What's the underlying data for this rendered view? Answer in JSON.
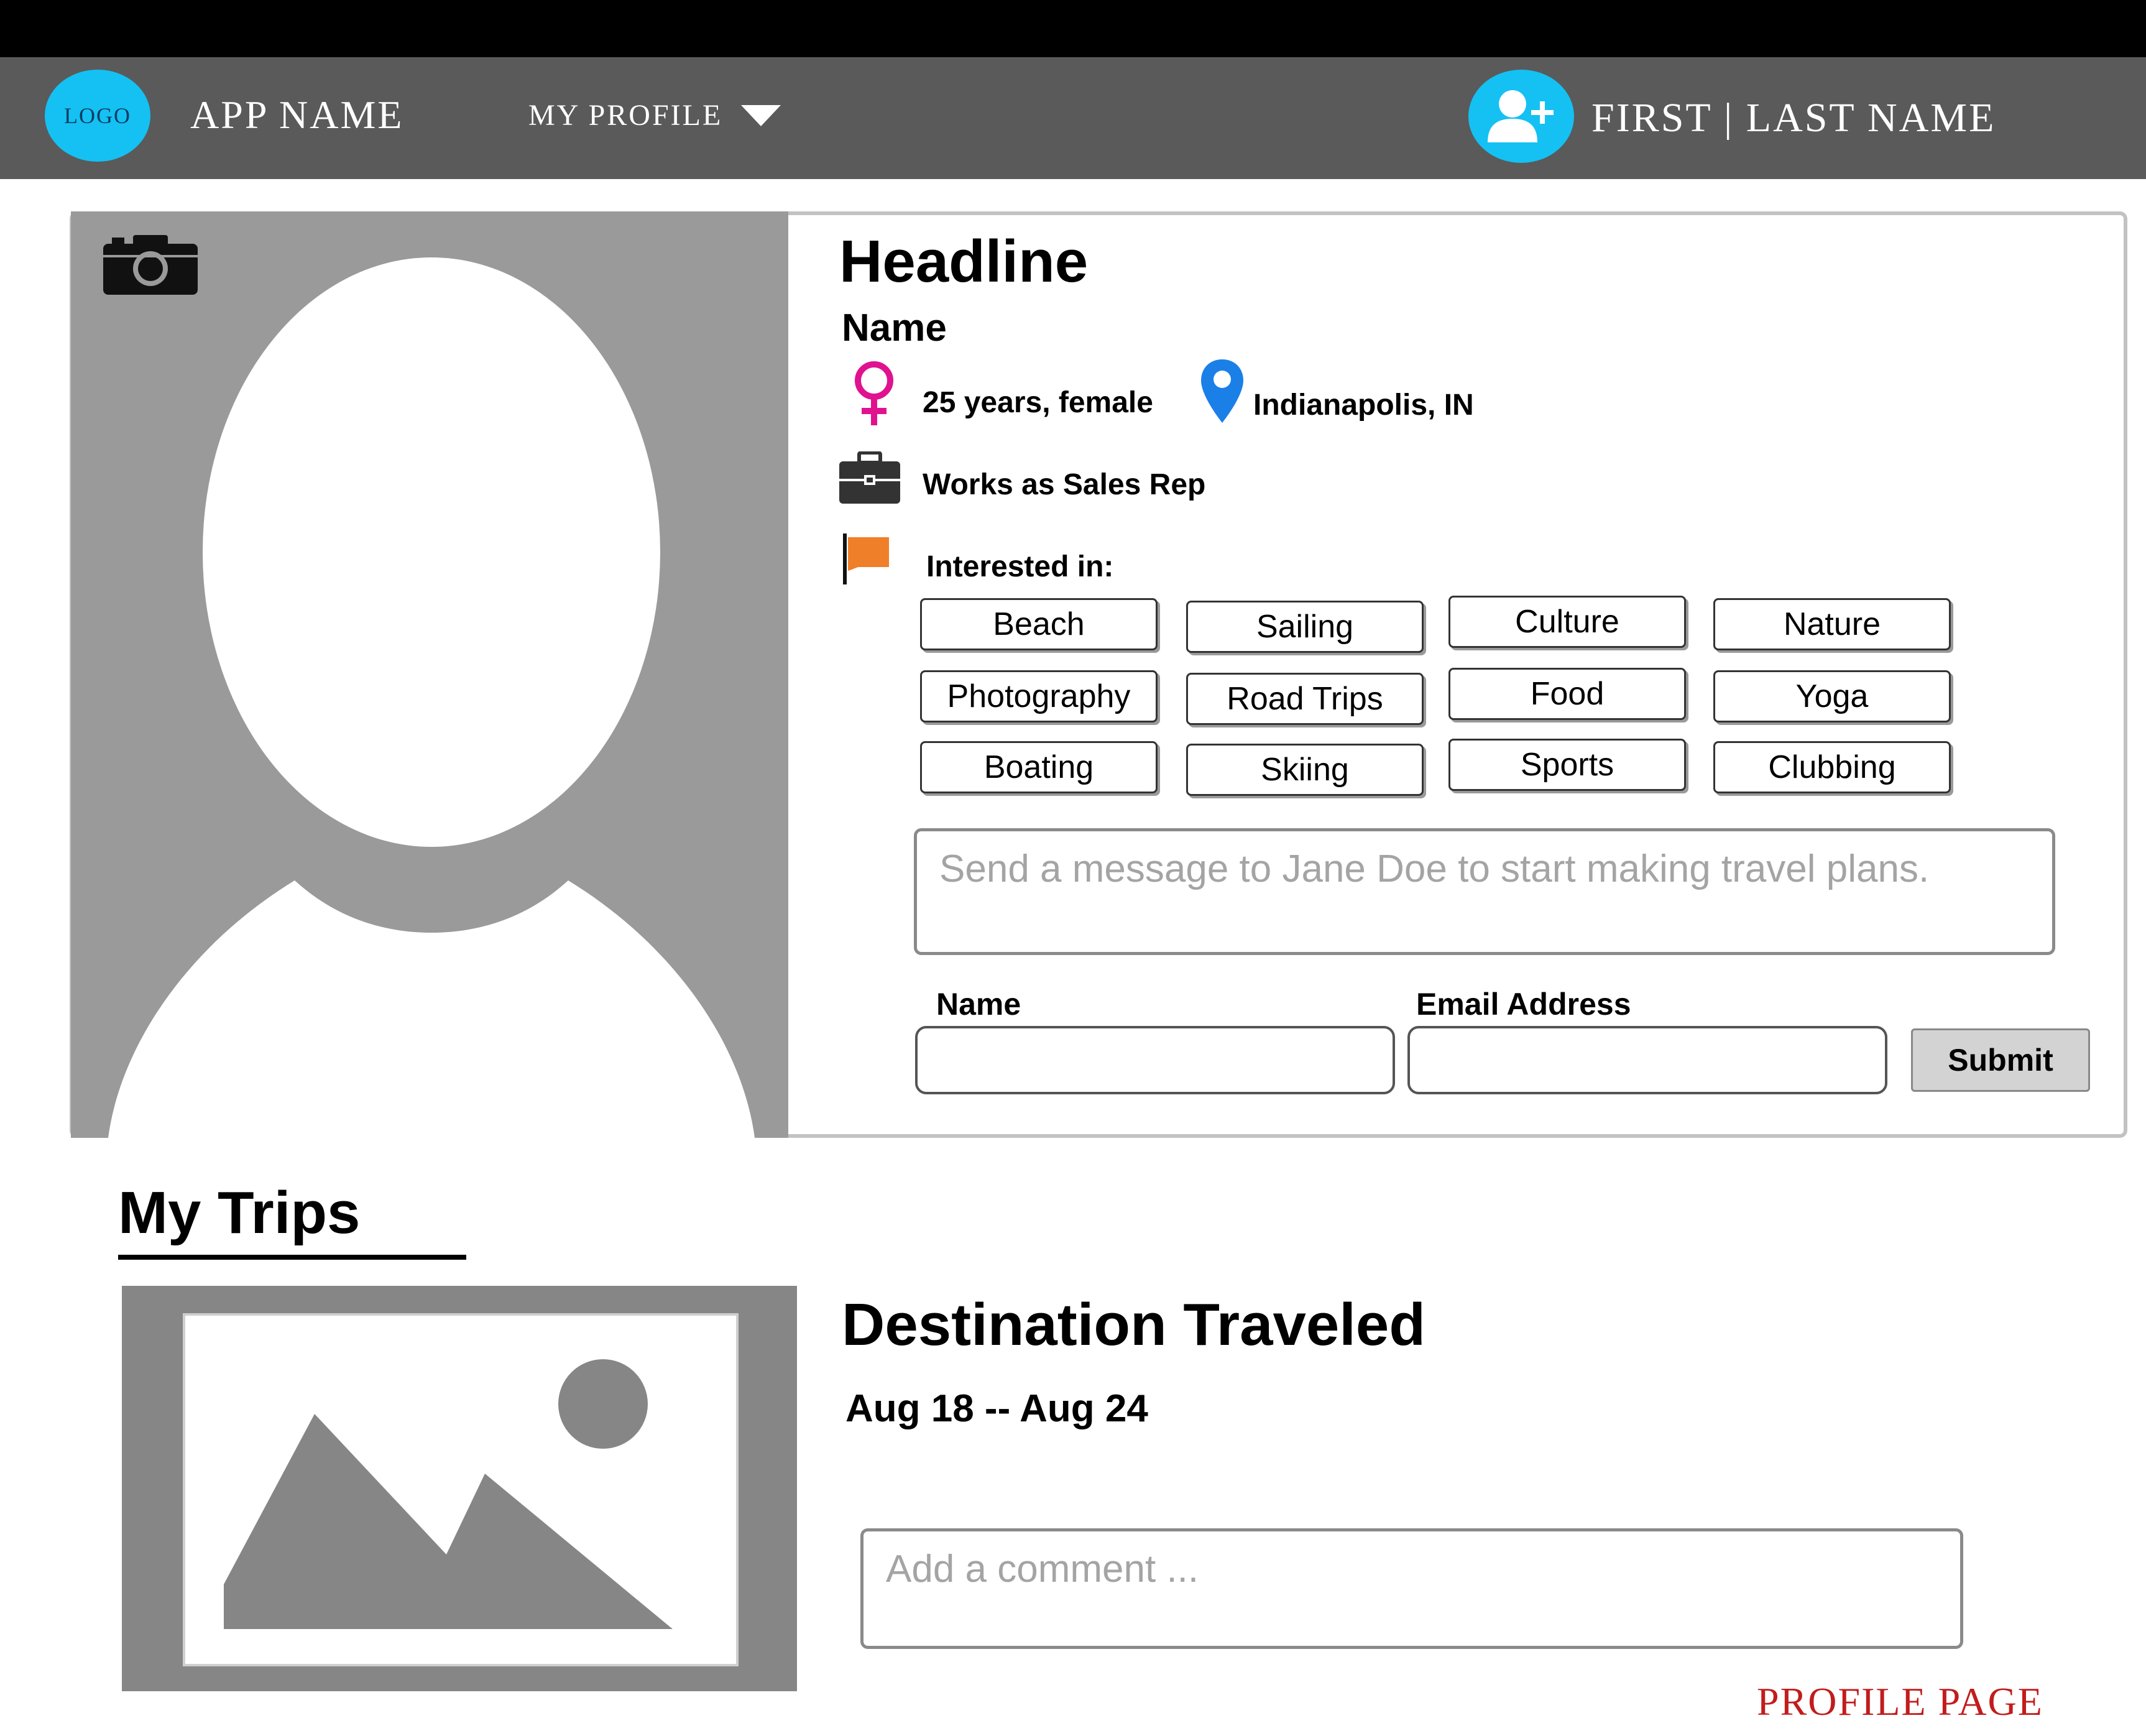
{
  "header": {
    "logo_text": "LOGO",
    "app_name": "APP NAME",
    "menu_label": "MY PROFILE",
    "user_name": "FIRST | LAST NAME"
  },
  "profile": {
    "headline": "Headline",
    "name": "Name",
    "age_gender": "25 years, female",
    "location": "Indianapolis, IN",
    "occupation": "Works as Sales Rep",
    "interests_label": "Interested in:",
    "interests": [
      "Beach",
      "Sailing",
      "Culture",
      "Nature",
      "Photography",
      "Road Trips",
      "Food",
      "Yoga",
      "Boating",
      "Skiing",
      "Sports",
      "Clubbing"
    ]
  },
  "message_form": {
    "message_placeholder": "Send a message to Jane Doe to start making travel plans.",
    "name_label": "Name",
    "email_label": "Email Address",
    "submit_label": "Submit"
  },
  "trips": {
    "section_title": "My Trips",
    "destination": "Destination Traveled",
    "dates": "Aug 18 -- Aug 24",
    "comment_placeholder": "Add a comment ..."
  },
  "page_caption": "PROFILE PAGE",
  "colors": {
    "accent_cyan": "#14c1f2",
    "navbar": "#5a5a5a",
    "female_icon": "#e0128f",
    "location_pin": "#1b7fe8",
    "flag": "#f07f2a",
    "caption": "#c21c1c"
  },
  "icons": {
    "camera": "camera-icon",
    "add_user": "add-user-icon",
    "female": "female-symbol-icon",
    "location": "location-pin-icon",
    "work": "briefcase-icon",
    "interests": "flag-icon",
    "placeholder_image": "image-placeholder-icon"
  }
}
